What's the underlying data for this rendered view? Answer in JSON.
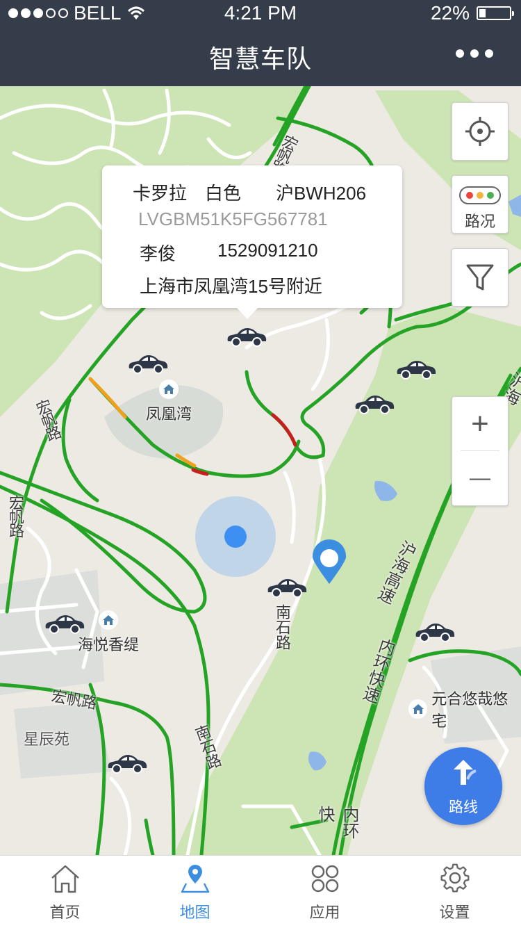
{
  "status_bar": {
    "carrier": "BELL",
    "time": "4:21 PM",
    "battery": "22%",
    "battery_level": 0.22,
    "signal_bars": 3
  },
  "header": {
    "title": "智慧车队"
  },
  "map": {
    "road_labels": [
      "宏帆路",
      "宏帆路",
      "宏帆路",
      "宏帆路",
      "南石路",
      "南石路",
      "沪海高速",
      "内环快速",
      "内环快",
      "沪海"
    ],
    "poi_labels": [
      "凤凰湾",
      "海悦香缇",
      "元合悠哉悠宅",
      "星辰苑"
    ],
    "traffic_button": {
      "label": "路况"
    },
    "route_button": {
      "label": "路线"
    },
    "zoom_in": "+",
    "zoom_out": "—"
  },
  "vehicle_popup": {
    "model": "卡罗拉",
    "color": "白色",
    "plate": "沪BWH206",
    "vin": "LVGBM51K5FG567781",
    "driver": "李俊",
    "phone": "1529091210",
    "location": "上海市凤凰湾15号附近"
  },
  "tabs": [
    {
      "label": "首页",
      "icon": "home-icon",
      "active": false
    },
    {
      "label": "地图",
      "icon": "map-pin-icon",
      "active": true
    },
    {
      "label": "应用",
      "icon": "apps-grid-icon",
      "active": false
    },
    {
      "label": "设置",
      "icon": "gear-icon",
      "active": false
    }
  ],
  "colors": {
    "header": "#353c4a",
    "accent": "#3c8ee0",
    "traffic_green": "#24a324",
    "traffic_orange": "#f0a01e",
    "traffic_red": "#c81e1e",
    "park": "#cde4b4",
    "route_button": "#3e7de8"
  }
}
